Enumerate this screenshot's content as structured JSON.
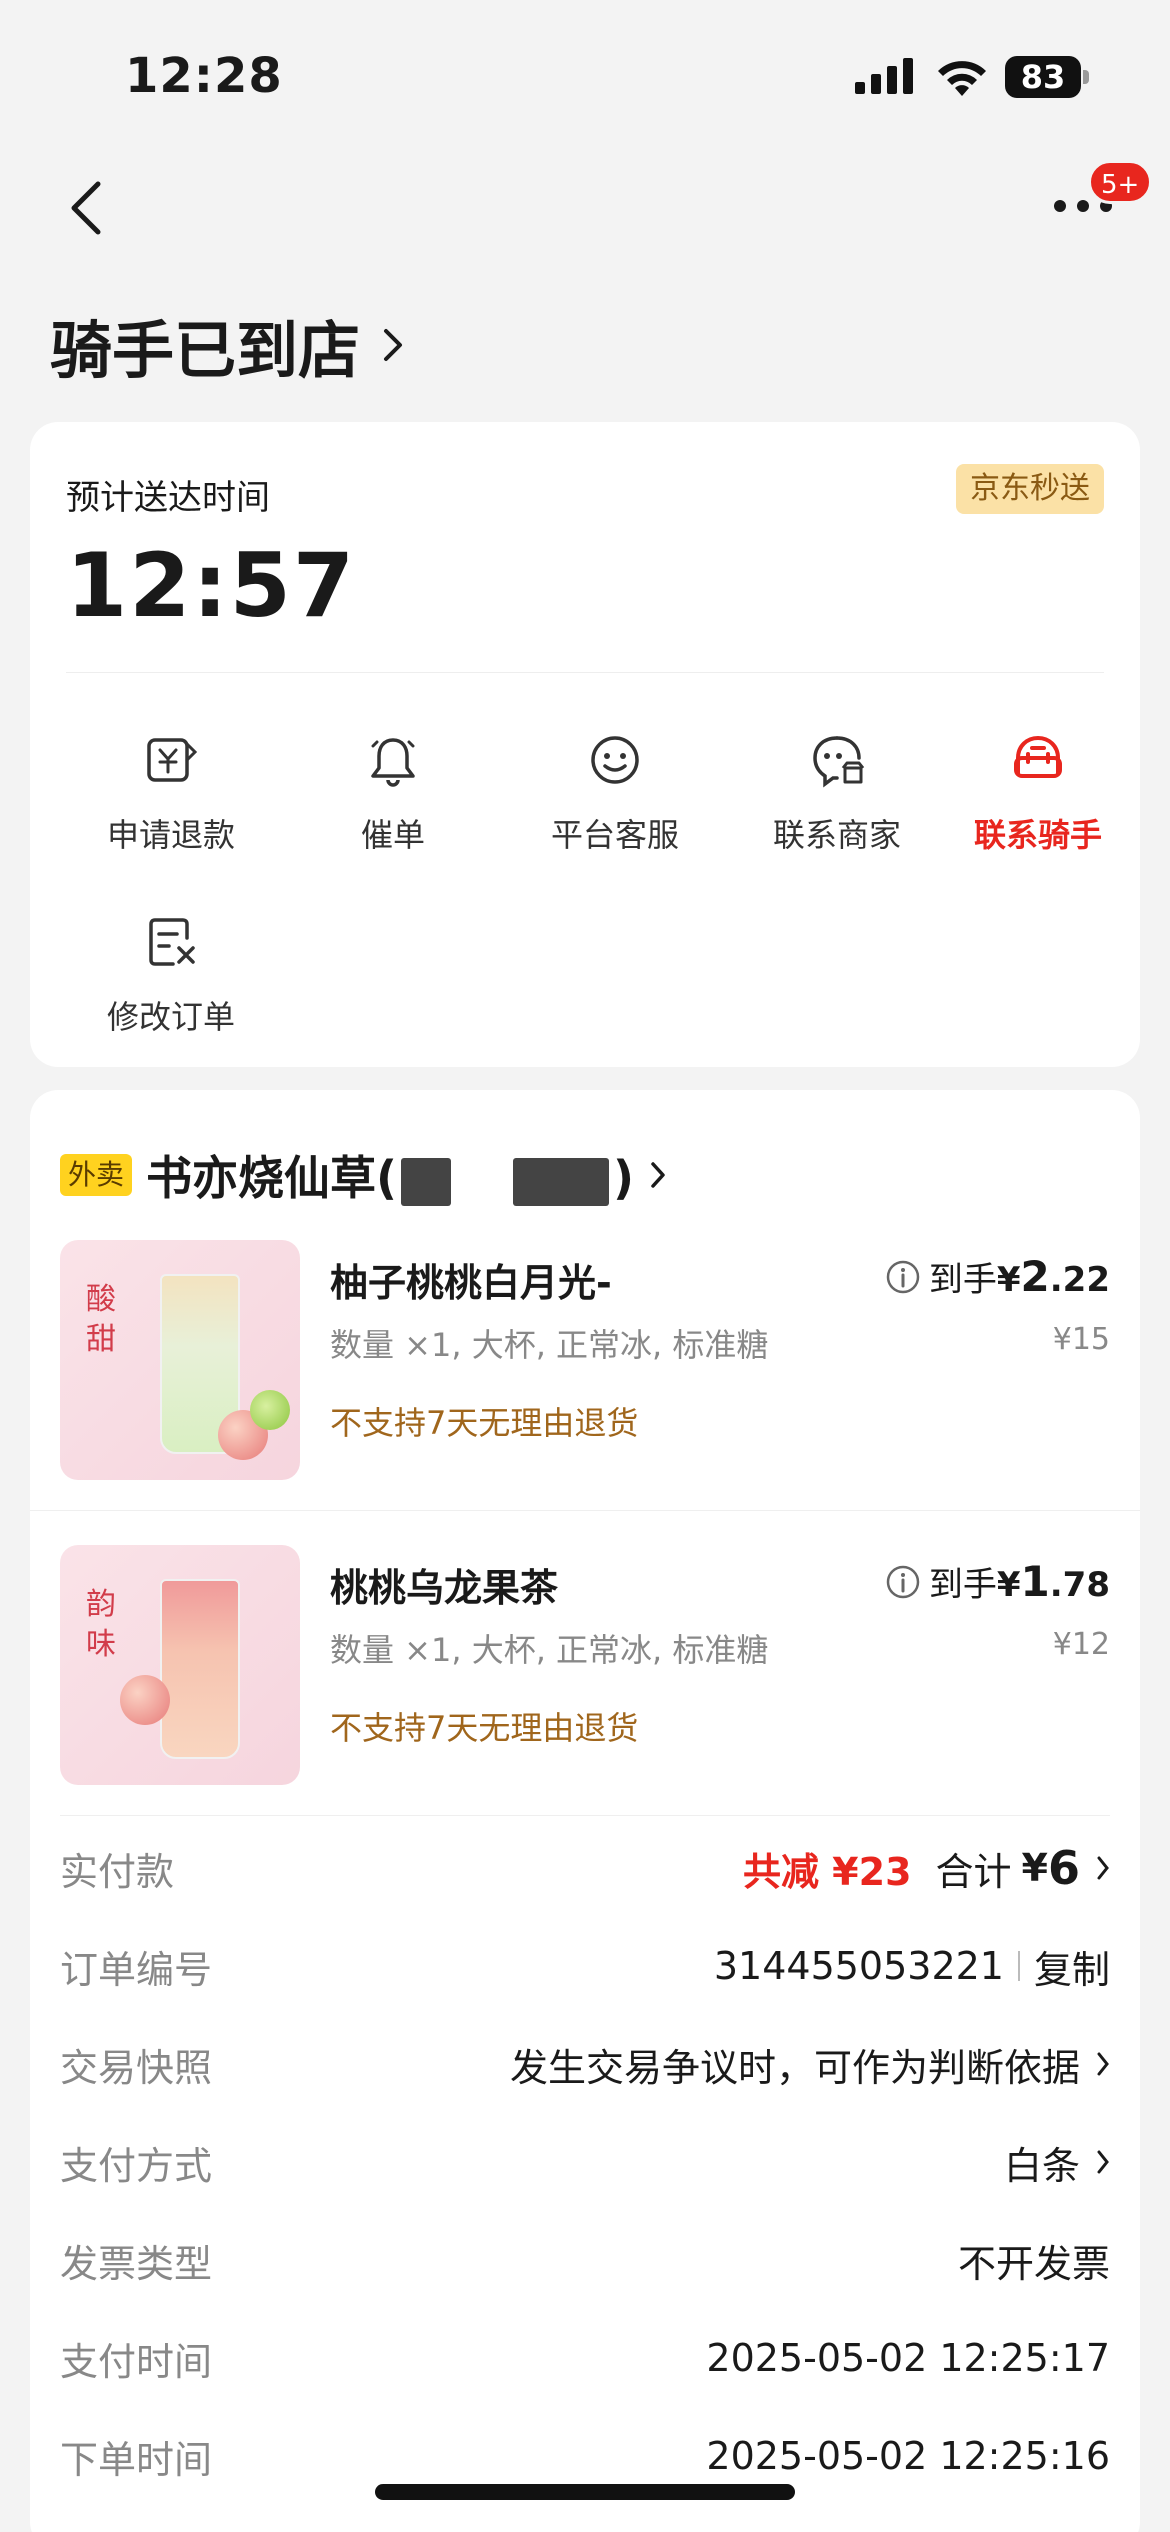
{
  "status_bar": {
    "time": "12:28",
    "battery": "83"
  },
  "header": {
    "more_badge": "5+"
  },
  "page_title": "骑手已到店",
  "eta_card": {
    "label": "预计送达时间",
    "time": "12:57",
    "tag": "京东秒送",
    "actions": [
      {
        "label": "申请退款",
        "icon": "refund-icon"
      },
      {
        "label": "催单",
        "icon": "bell-icon"
      },
      {
        "label": "平台客服",
        "icon": "customer-service-icon"
      },
      {
        "label": "联系商家",
        "icon": "merchant-chat-icon"
      },
      {
        "label": "联系骑手",
        "icon": "rider-icon"
      },
      {
        "label": "修改订单",
        "icon": "edit-order-icon"
      }
    ],
    "colors": {
      "accent_red": "#e8261e",
      "tag_bg": "#fbe1a6"
    }
  },
  "order": {
    "type_tag": "外卖",
    "shop_name_prefix": "书亦烧仙草(",
    "shop_name_suffix": ")",
    "items": [
      {
        "name": "柚子桃桃白月光-",
        "spec": "数量 ×1, 大杯, 正常冰, 标准糖",
        "note": "不支持7天无理由退货",
        "price_label": "到手",
        "price_symbol": "¥",
        "price_int": "2",
        "price_dec": ".22",
        "original_price": "¥15",
        "thumb_text": "酸甜"
      },
      {
        "name": "桃桃乌龙果茶",
        "spec": "数量 ×1, 大杯, 正常冰, 标准糖",
        "note": "不支持7天无理由退货",
        "price_label": "到手",
        "price_symbol": "¥",
        "price_int": "1",
        "price_dec": ".78",
        "original_price": "¥12",
        "thumb_text": "韵味"
      }
    ],
    "details": {
      "paid_label": "实付款",
      "discount": "共减 ¥23",
      "total_label": "合计",
      "total_symbol": "¥",
      "total_value": "6",
      "order_no_label": "订单编号",
      "order_no": "314455053221",
      "copy_label": "复制",
      "snapshot_label": "交易快照",
      "snapshot_value": "发生交易争议时，可作为判断依据",
      "pay_method_label": "支付方式",
      "pay_method_value": "白条",
      "invoice_label": "发票类型",
      "invoice_value": "不开发票",
      "pay_time_label": "支付时间",
      "pay_time_value": "2025-05-02 12:25:17",
      "order_time_label": "下单时间",
      "order_time_value": "2025-05-02 12:25:16"
    }
  }
}
